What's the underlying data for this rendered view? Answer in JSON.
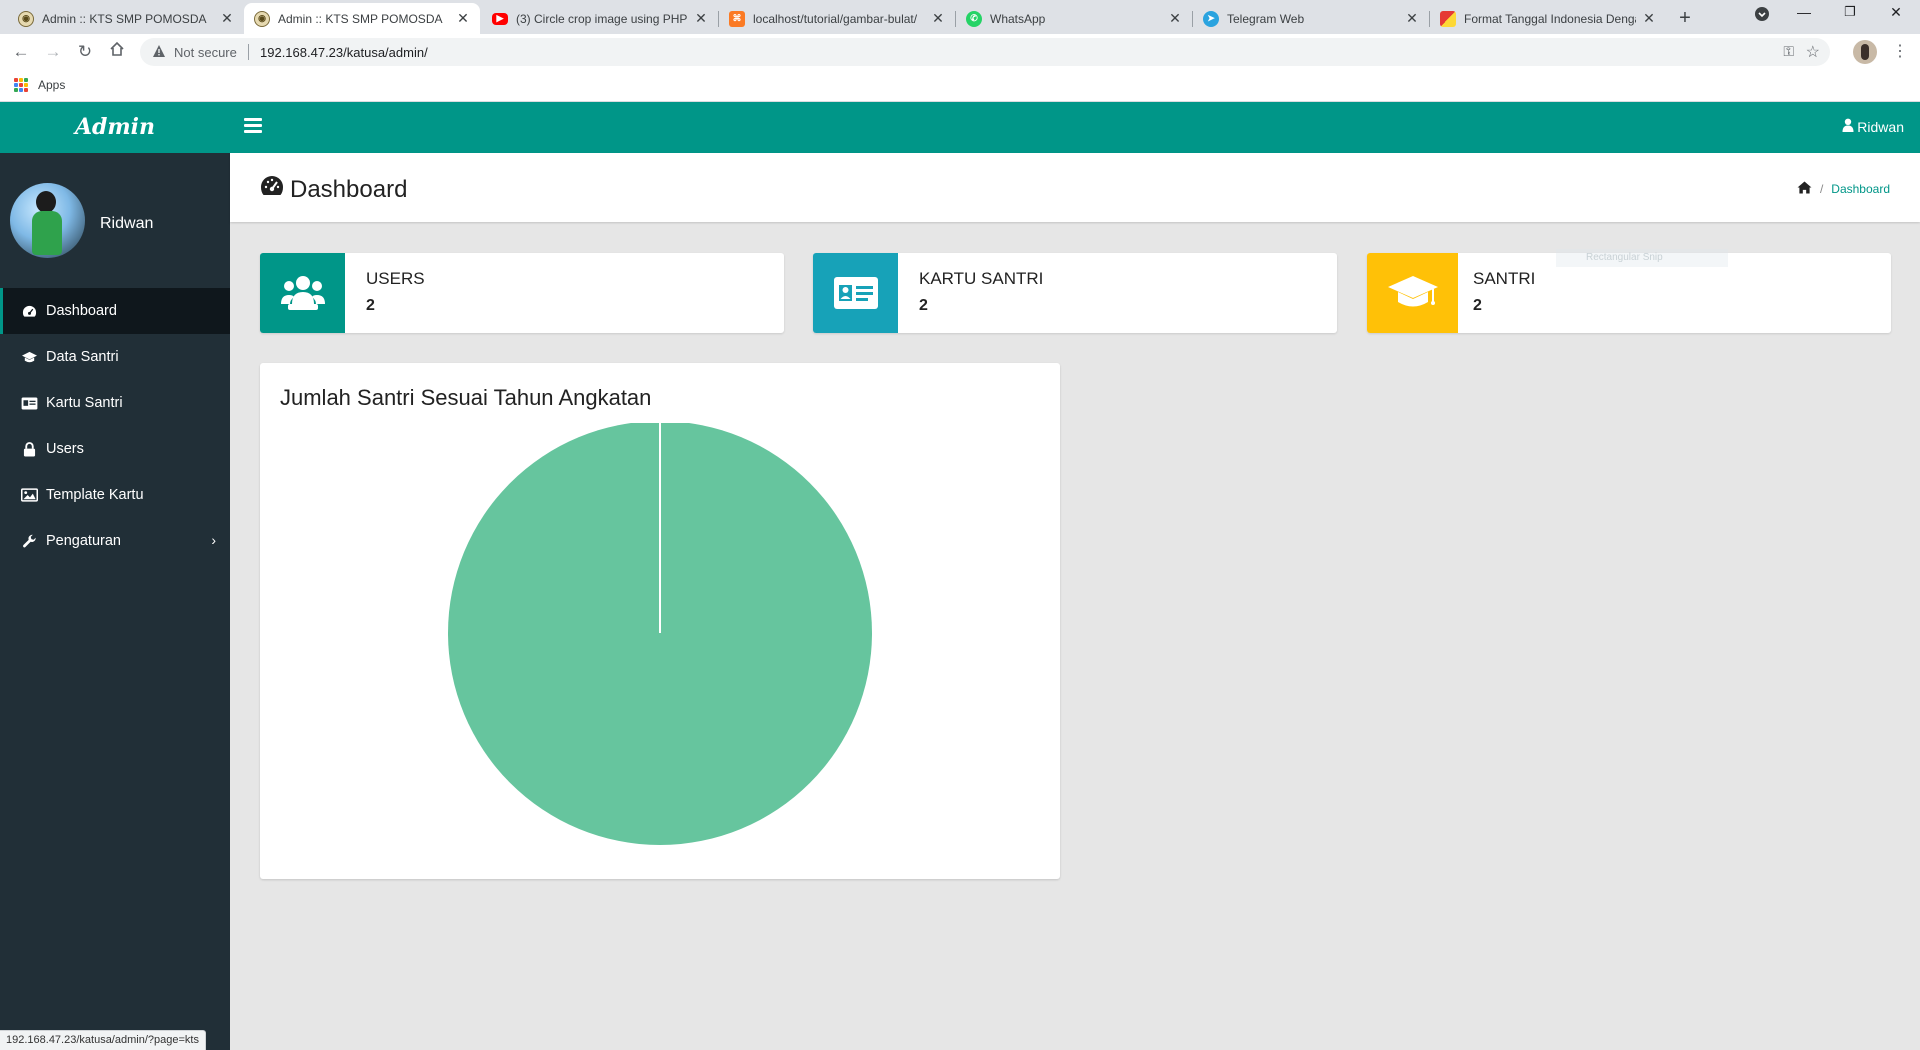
{
  "browser": {
    "tabs": [
      {
        "title": "Admin :: KTS SMP POMOSDA",
        "icon": "pomosda-logo-icon",
        "active": false
      },
      {
        "title": "Admin :: KTS SMP POMOSDA",
        "icon": "pomosda-logo-icon",
        "active": true
      },
      {
        "title": "(3) Circle crop image using PHP",
        "icon": "youtube-icon",
        "active": false
      },
      {
        "title": "localhost/tutorial/gambar-bulat/",
        "icon": "xampp-icon",
        "active": false
      },
      {
        "title": "WhatsApp",
        "icon": "whatsapp-icon",
        "active": false
      },
      {
        "title": "Telegram Web",
        "icon": "telegram-icon",
        "active": false
      },
      {
        "title": "Format Tanggal Indonesia Dengan",
        "icon": "blog-icon",
        "active": false
      }
    ],
    "not_secure": "Not secure",
    "url": "192.168.47.23/katusa/admin/",
    "bookmarks_apps": "Apps",
    "status_url": "192.168.47.23/katusa/admin/?page=kts"
  },
  "sidebar": {
    "brand": "Admin",
    "user_name": "Ridwan",
    "items": [
      {
        "label": "Dashboard",
        "icon": "dashboard-icon",
        "active": true
      },
      {
        "label": "Data Santri",
        "icon": "graduation-cap-icon",
        "active": false
      },
      {
        "label": "Kartu Santri",
        "icon": "id-card-icon",
        "active": false
      },
      {
        "label": "Users",
        "icon": "user-lock-icon",
        "active": false
      },
      {
        "label": "Template Kartu",
        "icon": "image-icon",
        "active": false
      },
      {
        "label": "Pengaturan",
        "icon": "wrench-icon",
        "active": false,
        "has_submenu": true
      }
    ]
  },
  "topbar": {
    "user": "Ridwan"
  },
  "page": {
    "title": "Dashboard",
    "breadcrumb": "Dashboard"
  },
  "stats": [
    {
      "label": "USERS",
      "value": "2",
      "color": "#009688",
      "icon": "users-icon"
    },
    {
      "label": "KARTU SANTRI",
      "value": "2",
      "color": "#17a2b8",
      "icon": "id-card-icon"
    },
    {
      "label": "SANTRI",
      "value": "2",
      "color": "#ffc107",
      "icon": "graduation-cap-icon"
    }
  ],
  "ghost_tooltip": "Rectangular Snip",
  "chart": {
    "title": "Jumlah Santri Sesuai Tahun Angkatan"
  },
  "chart_data": {
    "type": "pie",
    "title": "Jumlah Santri Sesuai Tahun Angkatan",
    "categories": [
      ""
    ],
    "values": [
      2
    ],
    "colors": [
      "#66c59e"
    ]
  },
  "colors": {
    "accent": "#009688",
    "sidebar": "#212f37",
    "sidebar_active": "#0f171c",
    "page_bg": "#e6e6e6"
  }
}
